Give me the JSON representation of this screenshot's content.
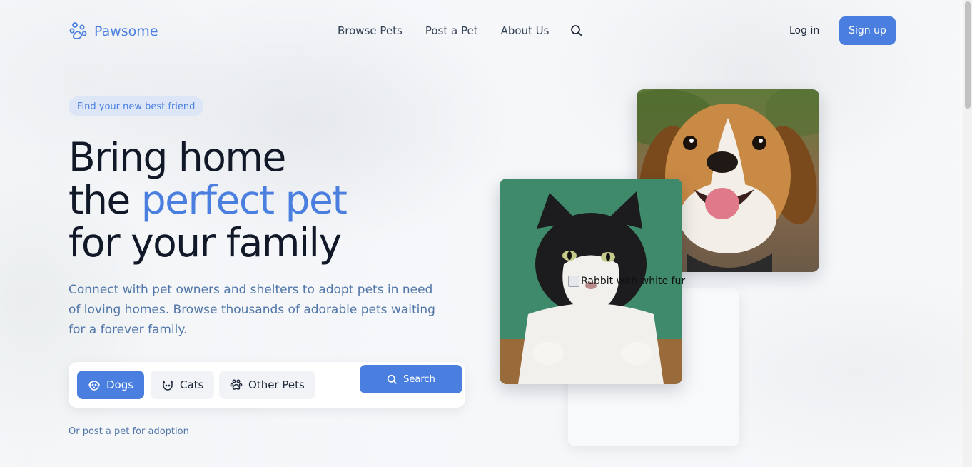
{
  "brand": {
    "name": "Pawsome",
    "icon": "paw-icon"
  },
  "nav": {
    "items": [
      {
        "label": "Browse Pets"
      },
      {
        "label": "Post a Pet"
      },
      {
        "label": "About Us"
      }
    ],
    "search_icon": "search-icon"
  },
  "auth": {
    "login_label": "Log in",
    "signup_label": "Sign up"
  },
  "hero": {
    "pill": "Find your new best friend",
    "headline_line1": "Bring home",
    "headline_line2_prefix": "the ",
    "headline_line2_accent": "perfect pet",
    "headline_line3": "for your family",
    "subtitle": "Connect with pet owners and shelters to adopt pets in need of loving homes. Browse thousands of adorable pets waiting for a forever family."
  },
  "search": {
    "tabs": [
      {
        "label": "Dogs",
        "icon": "dog-icon",
        "active": true
      },
      {
        "label": "Cats",
        "icon": "cat-icon",
        "active": false
      },
      {
        "label": "Other Pets",
        "icon": "paw-icon",
        "active": false
      }
    ],
    "button_label": "Search",
    "post_link": "Or post a pet for adoption"
  },
  "images": {
    "dog": "dog-photo",
    "cat": "cat-photo",
    "rabbit_alt": "Rabbit with white fur"
  },
  "colors": {
    "accent": "#4a7fe0",
    "muted_text": "#5176a8",
    "heading": "#111827"
  }
}
